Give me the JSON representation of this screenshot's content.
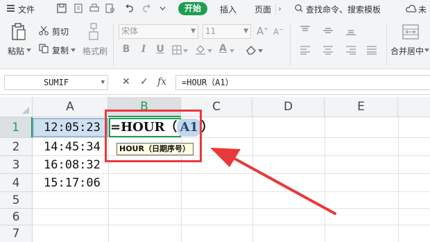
{
  "menu": {
    "file_label": "文件",
    "start_tab": "开始",
    "insert_tab": "插入",
    "page_tab": "页面",
    "overflow_glyph": "›",
    "search_placeholder": "查找命令、搜索模板",
    "cloud_status": "未保"
  },
  "ribbon": {
    "paste_label": "粘贴",
    "cut_label": "剪切",
    "copy_label": "复制",
    "format_painter_label": "格式刷",
    "font_name": "宋体",
    "font_size": "11",
    "bold_glyph": "B",
    "italic_glyph": "I",
    "underline_glyph": "U",
    "merge_center_label": "合并居中"
  },
  "formula_bar": {
    "name_box": "SUMIF",
    "cancel_glyph": "✕",
    "confirm_glyph": "✓",
    "fx_glyph": "fx",
    "content": "=HOUR（A1）"
  },
  "sheet": {
    "columns": [
      "A",
      "B",
      "C",
      "D",
      "E"
    ],
    "rows": [
      "1",
      "2",
      "3",
      "4",
      "5",
      "6",
      "7"
    ],
    "column_a_values": [
      "12:05:23",
      "14:45:34",
      "16:08:32",
      "15:17:06"
    ],
    "active_cell_formula": {
      "prefix": "=HOUR（",
      "reference": "A1",
      "suffix": "）"
    },
    "tooltip": "HOUR（日期序号）"
  },
  "colors": {
    "accent_green": "#1e9e52",
    "annotation_red": "#e8393b",
    "selection_blue": "#cfe0f3"
  }
}
